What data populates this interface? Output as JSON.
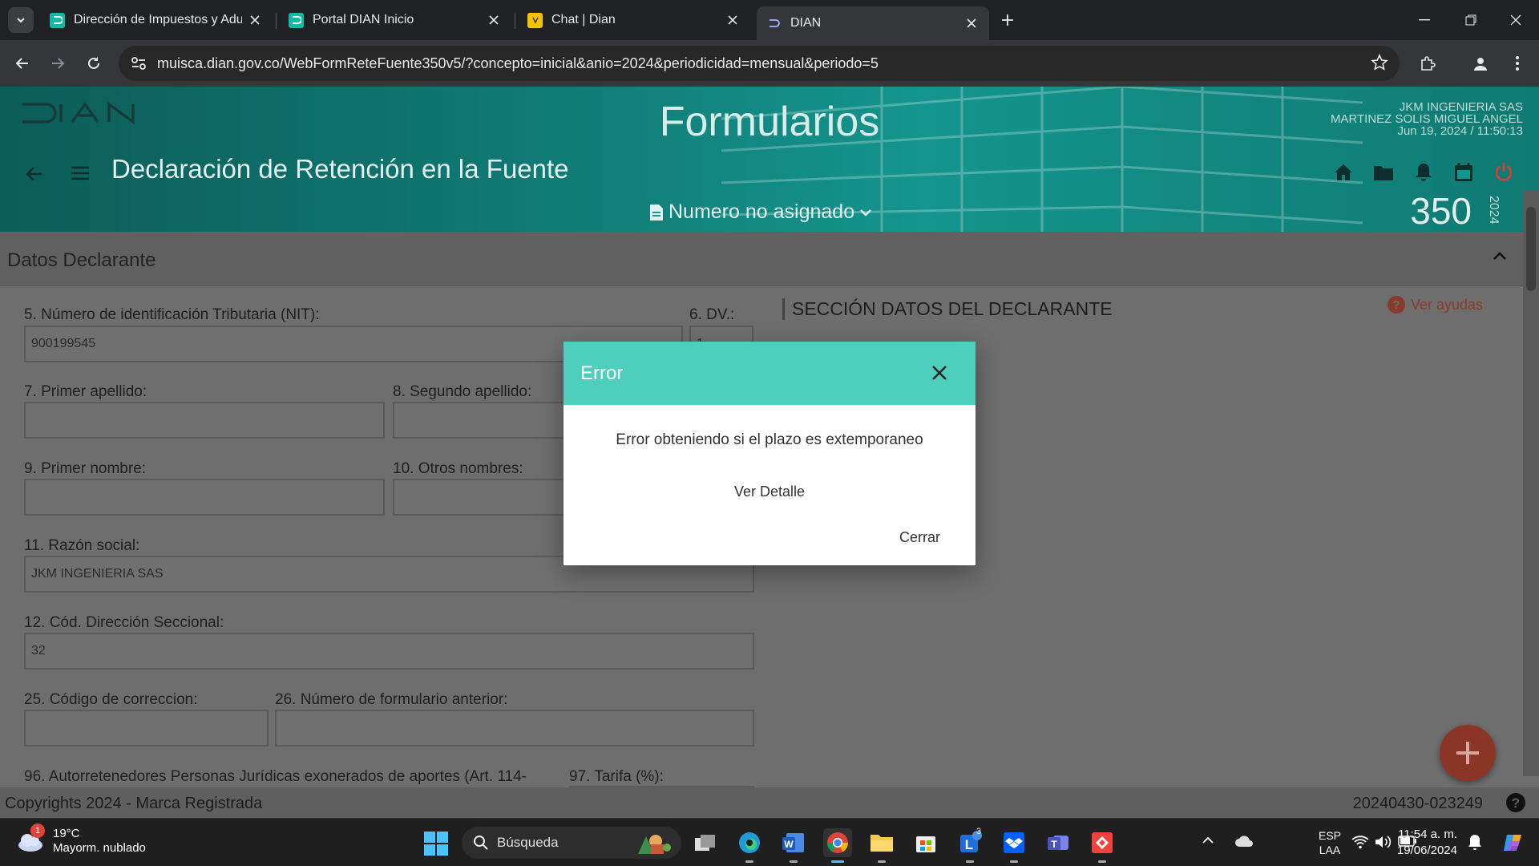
{
  "browser": {
    "tabs": [
      {
        "title": "Dirección de Impuestos y Aduanas",
        "active": false
      },
      {
        "title": "Portal DIAN Inicio",
        "active": false
      },
      {
        "title": "Chat | Dian",
        "active": false
      },
      {
        "title": "DIAN",
        "active": true
      }
    ],
    "url": "muisca.dian.gov.co/WebFormReteFuente350v5/?concepto=inicial&anio=2024&periodicidad=mensual&periodo=5"
  },
  "header": {
    "logo": "DIAN",
    "title": "Formularios",
    "company": "JKM INGENIERIA SAS",
    "user": "MARTINEZ SOLIS MIGUEL ANGEL",
    "datetime": "Jun 19, 2024 / 11:50:13",
    "form_title": "Declaración de Retención en la Fuente",
    "number_status": "Numero no asignado",
    "form_number": "350",
    "form_year": "2024"
  },
  "section": {
    "title": "Datos Declarante",
    "heading": "SECCIÓN DATOS DEL DECLARANTE",
    "help": "Ver ayudas"
  },
  "fields": {
    "nit_label": "5. Número de identificación Tributaria (NIT):",
    "nit_value": "900199545",
    "dv_label": "6. DV.:",
    "dv_value": "1",
    "ap1_label": "7. Primer apellido:",
    "ap2_label": "8. Segundo apellido:",
    "nom1_label": "9. Primer nombre:",
    "nom2_label": "10. Otros nombres:",
    "razon_label": "11. Razón social:",
    "razon_value": "JKM INGENIERIA SAS",
    "cod_label": "12. Cód. Dirección Seccional:",
    "cod_value": "32",
    "corr_label": "25. Código de correccion:",
    "ant_label": "26. Número de formulario anterior:",
    "auto_label": "96. Autorretenedores Personas Jurídicas exonerados de aportes (Art. 114-",
    "tarifa_label": "97. Tarifa (%):"
  },
  "footer": {
    "copyright": "Copyrights 2024 - Marca Registrada",
    "version": "20240430-023249"
  },
  "modal": {
    "title": "Error",
    "message": "Error obteniendo si el plazo es extemporaneo",
    "detail": "Ver Detalle",
    "close": "Cerrar"
  },
  "taskbar": {
    "weather_temp": "19°C",
    "weather_desc": "Mayorm. nublado",
    "weather_badge": "1",
    "search": "Búsqueda",
    "lang1": "ESP",
    "lang2": "LAA",
    "time": "11:54 a. m.",
    "date": "19/06/2024",
    "teams_badge": "3"
  },
  "colors": {
    "modal_header": "#4ecfbe",
    "fab": "#8a3526",
    "power": "#e53935"
  }
}
